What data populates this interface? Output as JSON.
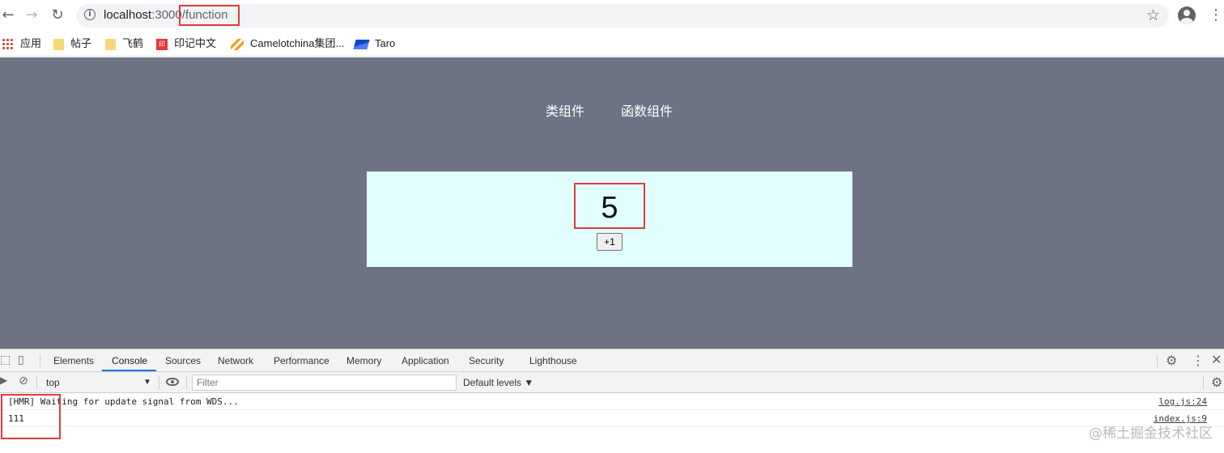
{
  "browser": {
    "url_host": "localhost",
    "url_port": ":3000",
    "url_path": "/function",
    "bookmarks": [
      "应用",
      "帖子",
      "飞鹤",
      "印记中文",
      "Camelotchina集团...",
      "Taro"
    ]
  },
  "page": {
    "nav": [
      "类组件",
      "函数组件"
    ],
    "count": "5",
    "increment_label": "+1",
    "background_color": "#6d7383",
    "card_color": "#e0fefe"
  },
  "devtools": {
    "tabs": [
      "Elements",
      "Console",
      "Sources",
      "Network",
      "Performance",
      "Memory",
      "Application",
      "Security",
      "Lighthouse"
    ],
    "active_tab": "Console",
    "context": "top",
    "filter_placeholder": "Filter",
    "levels": "Default levels ▼",
    "logs": [
      {
        "message": "[HMR] Waiting for update signal from WDS...",
        "source": "log.js:24"
      },
      {
        "message": "111",
        "source": "index.js:9"
      }
    ]
  },
  "watermark": "@稀土掘金技术社区"
}
